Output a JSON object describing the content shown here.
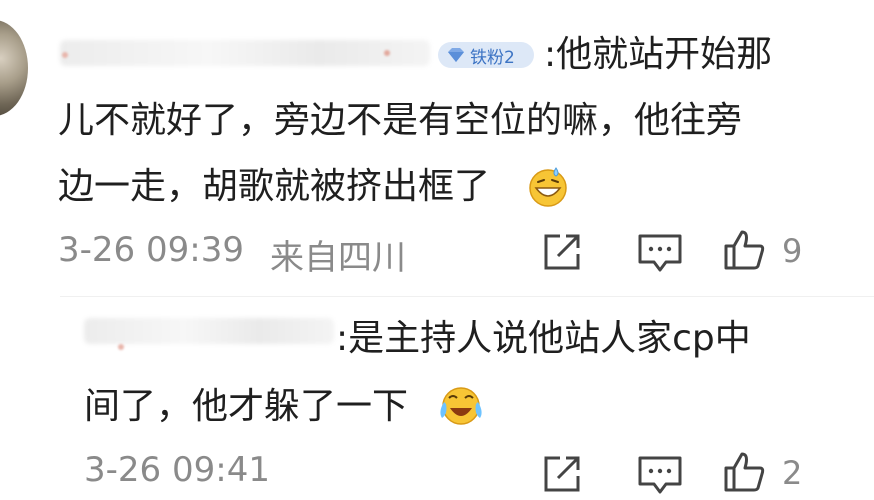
{
  "comment": {
    "badge_label": "铁粉2",
    "line1": ":他就站开始那",
    "line2": "儿不就好了，旁边不是有空位的嘛，他往旁",
    "line3": "边一走，胡歌就被挤出框了",
    "emoji": "grin-sweat",
    "timestamp": "3-26 09:39",
    "location": "来自四川",
    "like_count": "9"
  },
  "reply": {
    "line1": ":是主持人说他站人家cp中",
    "line2": "间了，他才躲了一下",
    "emoji": "laugh-cry",
    "timestamp": "3-26 09:41",
    "like_count": "2"
  },
  "icons": {
    "share": "share-icon",
    "comment": "comment-icon",
    "like": "thumbs-up-icon"
  }
}
